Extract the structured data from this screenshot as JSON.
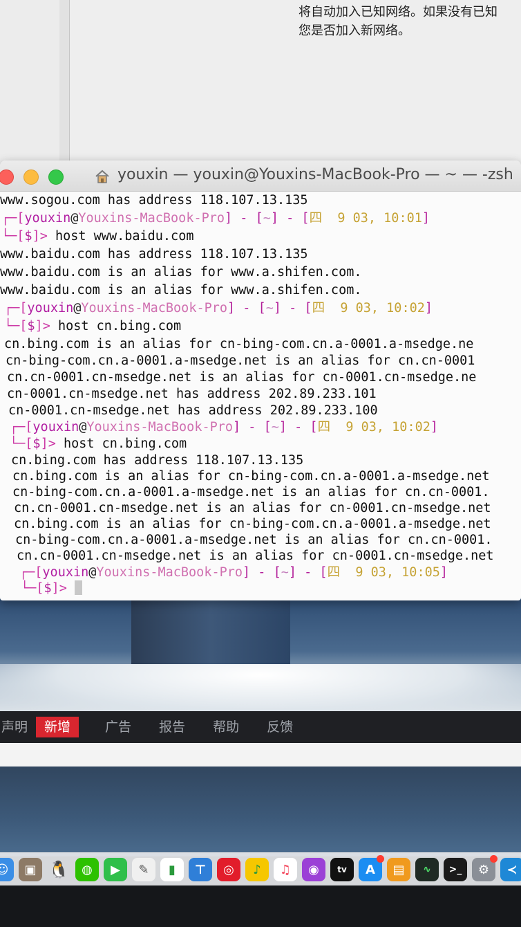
{
  "prefs": {
    "notice_line1": "将自动加入已知网络。如果没有已知",
    "notice_line2": "您是否加入新网络。"
  },
  "terminal": {
    "title": "youxin — youxin@Youxins-MacBook-Pro — ~ — -zsh",
    "prompt": {
      "user": "youxin",
      "at": "@",
      "host": "Youxins-MacBook-Pro",
      "dir": "~",
      "dollar": "$"
    },
    "lines": {
      "l0": "www.sogou.com has address 118.107.13.135",
      "p1_date": "四  9 03, 10:01",
      "c1": "host www.baidu.com",
      "l2": "www.baidu.com has address 118.107.13.135",
      "l3": "www.baidu.com is an alias for www.a.shifen.com.",
      "l4": "www.baidu.com is an alias for www.a.shifen.com.",
      "p2_date": "四  9 03, 10:02",
      "c2": "host cn.bing.com",
      "l6": "cn.bing.com is an alias for cn-bing-com.cn.a-0001.a-msedge.ne",
      "l7": "cn-bing-com.cn.a-0001.a-msedge.net is an alias for cn.cn-0001",
      "l8": "cn.cn-0001.cn-msedge.net is an alias for cn-0001.cn-msedge.ne",
      "l9": "cn-0001.cn-msedge.net has address 202.89.233.101",
      "l10": "cn-0001.cn-msedge.net has address 202.89.233.100",
      "p3_date": "四  9 03, 10:02",
      "c3": "host cn.bing.com",
      "l12": "cn.bing.com has address 118.107.13.135",
      "l13": "cn.bing.com is an alias for cn-bing-com.cn.a-0001.a-msedge.net",
      "l14": "cn-bing-com.cn.a-0001.a-msedge.net is an alias for cn.cn-0001.",
      "l15": "cn.cn-0001.cn-msedge.net is an alias for cn-0001.cn-msedge.net",
      "l16": "cn.bing.com is an alias for cn-bing-com.cn.a-0001.a-msedge.net",
      "l17": "cn-bing-com.cn.a-0001.a-msedge.net is an alias for cn.cn-0001.",
      "l18": "cn.cn-0001.cn-msedge.net is an alias for cn-0001.cn-msedge.net",
      "p4_date": "四  9 03, 10:05"
    }
  },
  "webbar": {
    "tab0": "声明",
    "tab_active": "新增",
    "tab1": "广告",
    "tab2": "报告",
    "tab3": "帮助",
    "tab4": "反馈"
  },
  "dock": {
    "icons": [
      "finder-icon",
      "package-icon",
      "qq-icon",
      "wechat-icon",
      "facetime-icon",
      "text-edit-icon",
      "numbers-icon",
      "keynote-icon",
      "netease-music-icon",
      "qq-music-icon",
      "music-icon",
      "podcasts-icon",
      "apple-tv-icon",
      "app-store-icon",
      "books-icon",
      "activity-monitor-icon",
      "terminal-icon",
      "system-preferences-icon",
      "vscode-icon"
    ]
  },
  "colors": {
    "prompt_magenta": "#b31f9a",
    "date_yellow": "#c6a335",
    "active_tab_red": "#d9262f"
  }
}
